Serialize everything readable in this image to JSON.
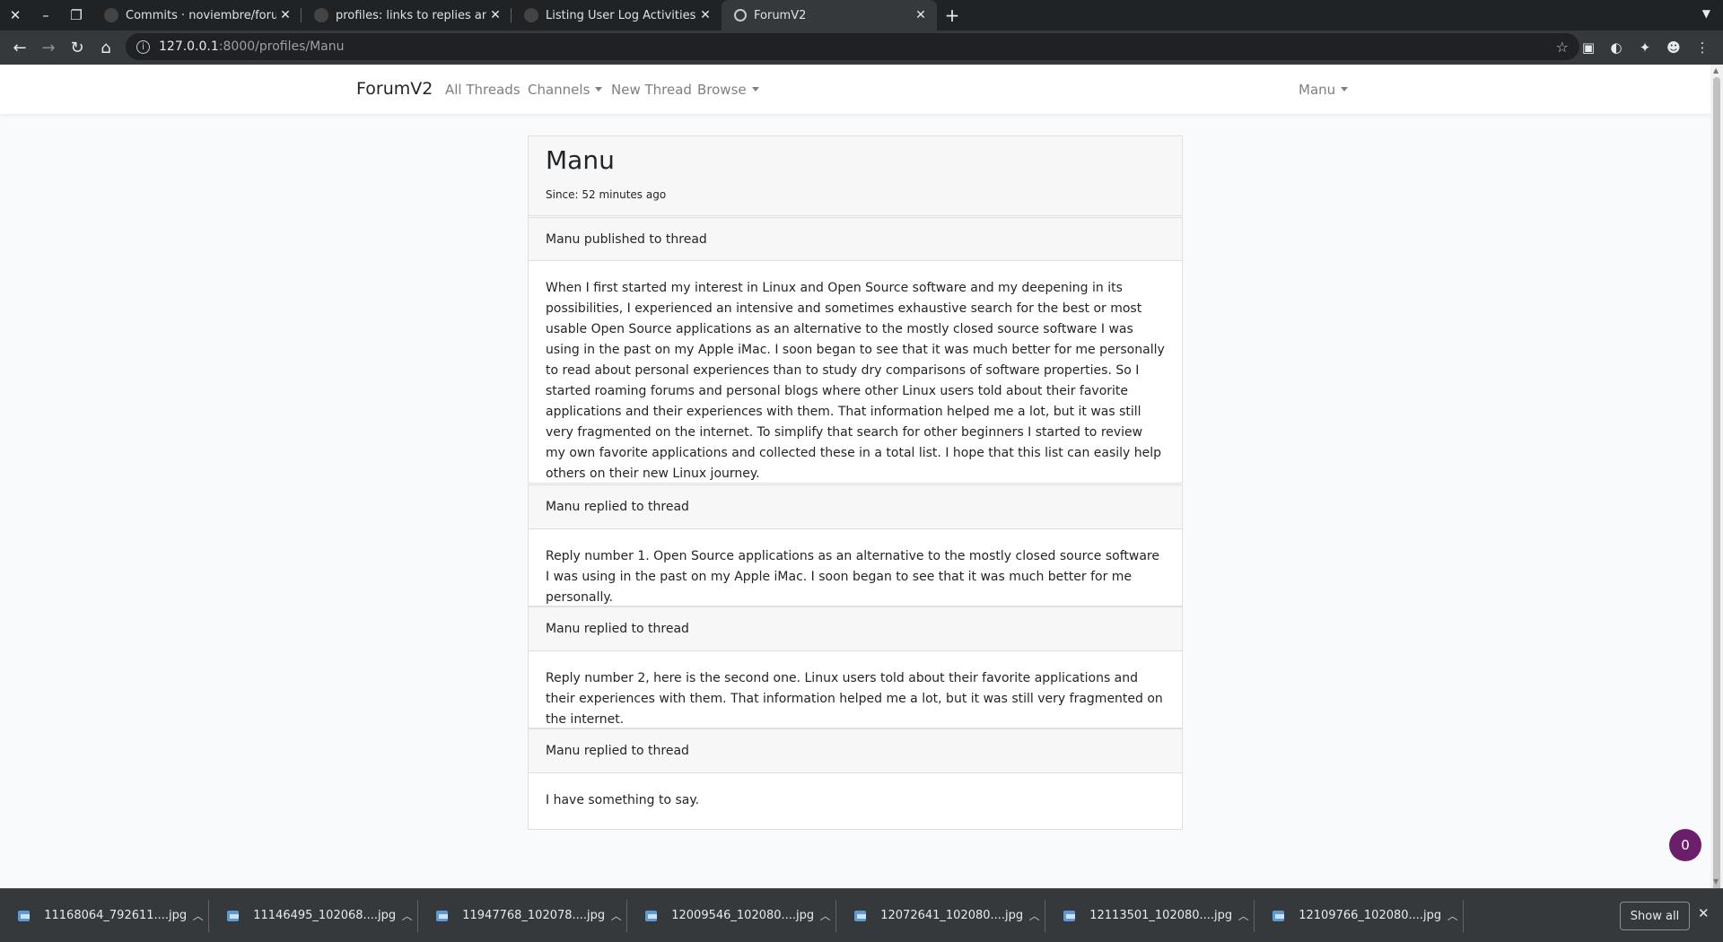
{
  "browser": {
    "tabs": [
      {
        "title": "Commits · noviembre/forumttd",
        "active": false
      },
      {
        "title": "profiles: links to replies and thr",
        "active": false
      },
      {
        "title": "Listing User Log Activities · nov",
        "active": false
      },
      {
        "title": "ForumV2",
        "active": true
      }
    ],
    "url_host": "127.0.0.1",
    "url_rest": ":8000/profiles/Manu",
    "extension_badge": "0"
  },
  "navbar": {
    "brand": "ForumV2",
    "links": {
      "all_threads": "All Threads",
      "channels": "Channels",
      "new_thread": "New Thread",
      "browse": "Browse"
    },
    "user": "Manu"
  },
  "profile": {
    "name": "Manu",
    "since": "Since: 52 minutes ago"
  },
  "activities": [
    {
      "header": "Manu published to thread",
      "body": "When I first started my interest in Linux and Open Source software and my deepening in its possibilities, I experienced an intensive and sometimes exhaustive search for the best or most usable Open Source applications as an alternative to the mostly closed source software I was using in the past on my Apple iMac. I soon began to see that it was much better for me personally to read about personal experiences than to study dry comparisons of software properties. So I started roaming forums and personal blogs where other Linux users told about their favorite applications and their experiences with them. That information helped me a lot, but it was still very fragmented on the internet. To simplify that search for other beginners I started to review my own favorite applications and collected these in a total list. I hope that this list can easily help others on their new Linux journey."
    },
    {
      "header": "Manu replied to thread",
      "body": "Reply number 1. Open Source applications as an alternative to the mostly closed source software I was using in the past on my Apple iMac. I soon began to see that it was much better for me personally."
    },
    {
      "header": "Manu replied to thread",
      "body": "Reply number 2, here is the second one. Linux users told about their favorite applications and their experiences with them. That information helped me a lot, but it was still very fragmented on the internet."
    },
    {
      "header": "Manu replied to thread",
      "body": "I have something to say."
    }
  ],
  "notification_count": "0",
  "downloads": [
    "11168064_792611....jpg",
    "11146495_102068....jpg",
    "11947768_102078....jpg",
    "12009546_102080....jpg",
    "12072641_102080....jpg",
    "12113501_102080....jpg",
    "12109766_102080....jpg"
  ],
  "show_all_label": "Show all",
  "colors": {
    "badge": "#6b1f6b",
    "chrome_dark": "#1f2326",
    "chrome_toolbar": "#35393c"
  }
}
